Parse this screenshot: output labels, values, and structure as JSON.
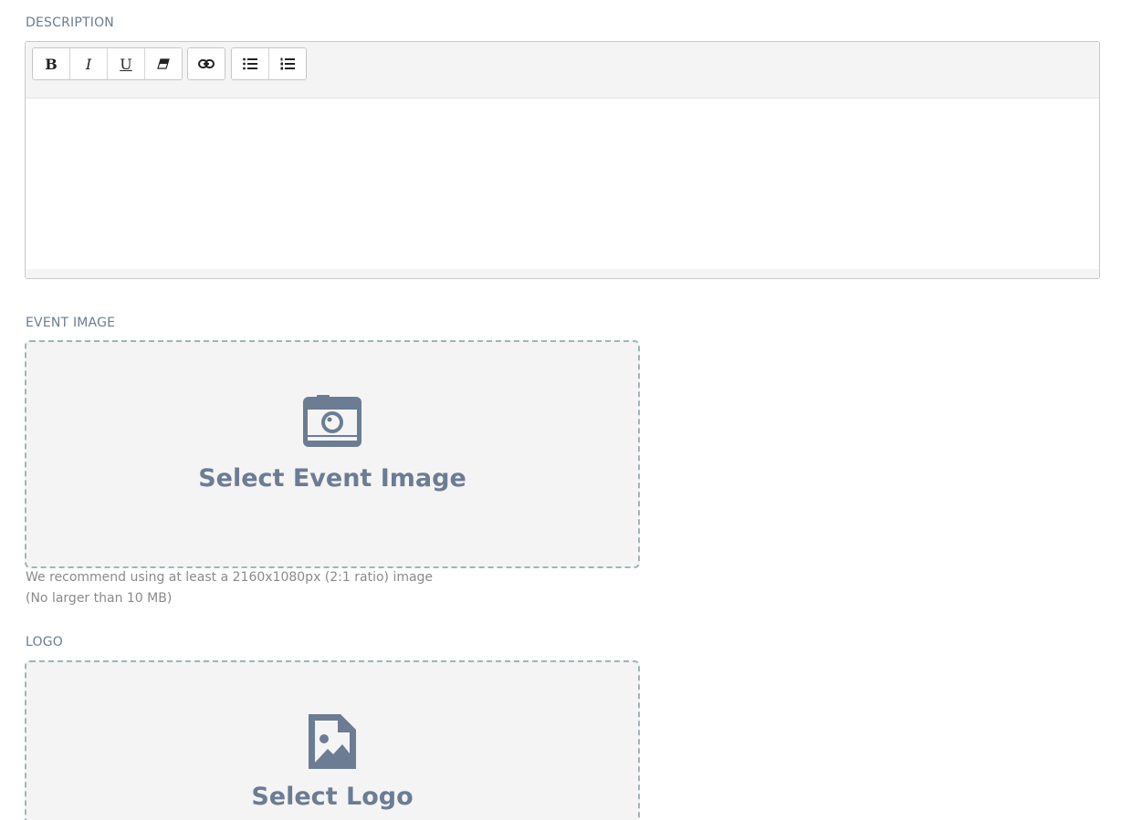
{
  "description": {
    "label": "DESCRIPTION",
    "toolbar": {
      "bold_label": "B",
      "italic_label": "I",
      "underline_label": "U",
      "icons": [
        "eraser-icon",
        "link-icon",
        "unordered-list-icon",
        "ordered-list-icon"
      ]
    },
    "content": ""
  },
  "event_image": {
    "label": "EVENT IMAGE",
    "button_text": "Select Event Image",
    "icon": "camera-icon",
    "hint_line1": "We recommend using at least a 2160x1080px (2:1 ratio) image",
    "hint_line2": "(No larger than 10 MB)"
  },
  "logo": {
    "label": "LOGO",
    "button_text": "Select Logo",
    "icon": "image-file-icon"
  },
  "colors": {
    "accent": "#6b7c93",
    "dropzone_bg": "#f4f4f4",
    "dropzone_border": "#9fb5b8"
  }
}
